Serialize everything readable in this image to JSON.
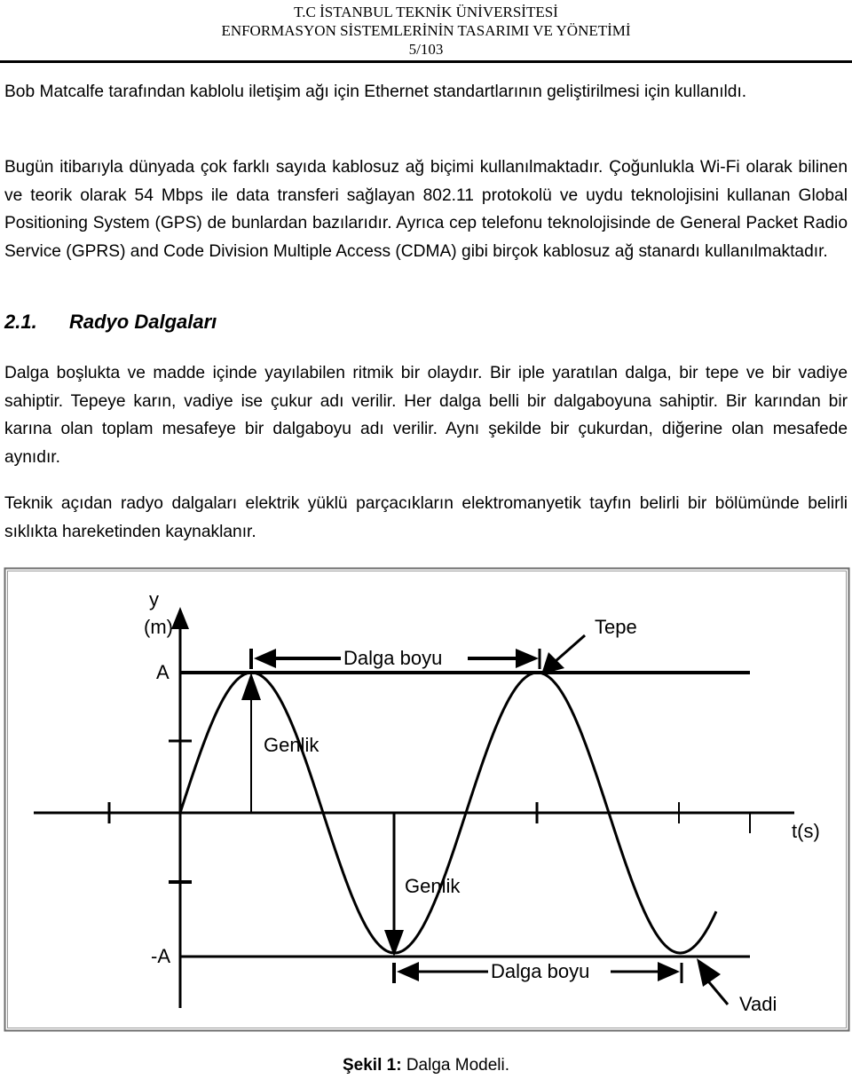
{
  "header": {
    "university": "T.C İSTANBUL TEKNİK ÜNİVERSİTESİ",
    "course": "ENFORMASYON SİSTEMLERİNİN TASARIMI VE YÖNETİMİ",
    "page_number": "5/103"
  },
  "body": {
    "paragraph_1": "Bob Matcalfe tarafından kablolu iletişim ağı için Ethernet standartlarının geliştirilmesi için kullanıldı.",
    "paragraph_2": "Bugün itibarıyla dünyada çok farklı sayıda kablosuz ağ biçimi kullanılmaktadır. Çoğunlukla Wi-Fi olarak bilinen ve teorik olarak 54 Mbps ile data transferi sağlayan 802.11 protokolü ve uydu teknolojisini kullanan Global Positioning System (GPS) de bunlardan bazılarıdır. Ayrıca cep telefonu teknolojisinde de General Packet Radio Service (GPRS) and Code Division Multiple Access (CDMA) gibi birçok kablosuz ağ stanardı kullanılmaktadır.",
    "section": {
      "number": "2.1.",
      "title": "Radyo Dalgaları"
    },
    "paragraph_3": "Dalga boşlukta ve madde içinde yayılabilen ritmik bir olaydır. Bir iple yaratılan dalga, bir tepe ve bir vadiye sahiptir. Tepeye karın, vadiye ise çukur adı verilir. Her dalga belli bir dalgaboyuna sahiptir. Bir karından bir karına olan toplam mesafeye bir dalgaboyu adı verilir. Aynı şekilde bir çukurdan, diğerine olan mesafede aynıdır.",
    "paragraph_4": "Teknik açıdan radyo dalgaları elektrik yüklü parçacıkların elektromanyetik tayfın belirli bir bölümünde belirli sıklıkta hareketinden kaynaklanır."
  },
  "figure": {
    "y_axis_label_1": "y",
    "y_axis_label_2": "(m)",
    "x_axis_label": "t(s)",
    "amplitude_top_label": "A",
    "amplitude_bottom_label": "-A",
    "wavelength_top_label": "Dalga boyu",
    "wavelength_bottom_label": "Dalga boyu",
    "amplitude_label_upper": "Genlik",
    "amplitude_label_lower": "Genlik",
    "crest_label": "Tepe",
    "trough_label": "Vadi",
    "wave": {
      "type": "sine",
      "amplitude": "A",
      "cycles_shown": 2
    }
  },
  "caption": {
    "prefix": "Şekil 1:",
    "text": "Dalga Modeli."
  }
}
